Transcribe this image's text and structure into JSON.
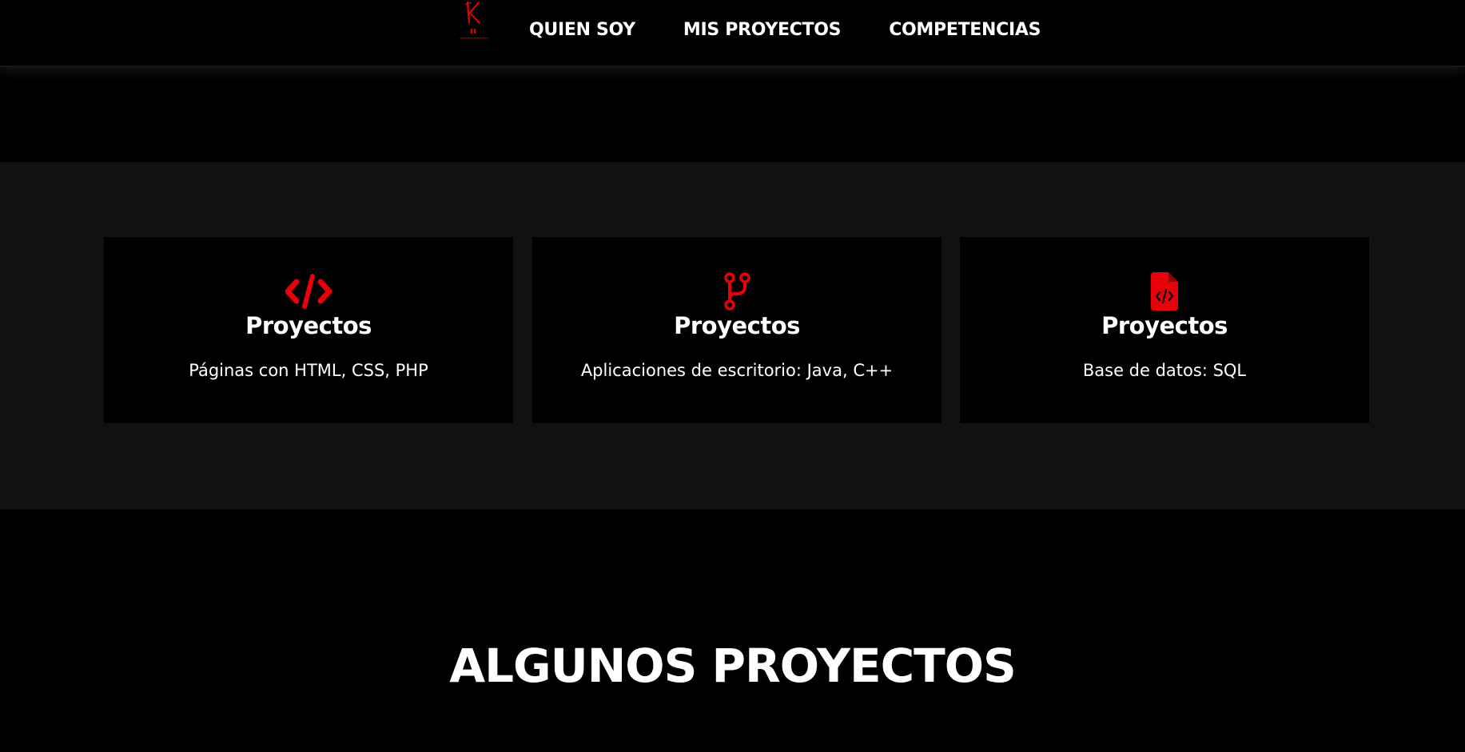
{
  "brand": {
    "accent_color": "#e8000a",
    "logo_icon": "k-monogram-logo-icon"
  },
  "nav": {
    "items": [
      {
        "label": "QUIEN SOY"
      },
      {
        "label": "MIS PROYECTOS"
      },
      {
        "label": "COMPETENCIAS"
      }
    ]
  },
  "services": {
    "background_color": "#101212",
    "cards": [
      {
        "icon": "code-icon",
        "title": "Proyectos",
        "description": "Páginas con HTML, CSS, PHP"
      },
      {
        "icon": "code-branch-icon",
        "title": "Proyectos",
        "description": "Aplicaciones de escritorio: Java, C++"
      },
      {
        "icon": "file-code-icon",
        "title": "Proyectos",
        "description": "Base de datos: SQL"
      }
    ]
  },
  "projects": {
    "heading": "ALGUNOS PROYECTOS"
  }
}
